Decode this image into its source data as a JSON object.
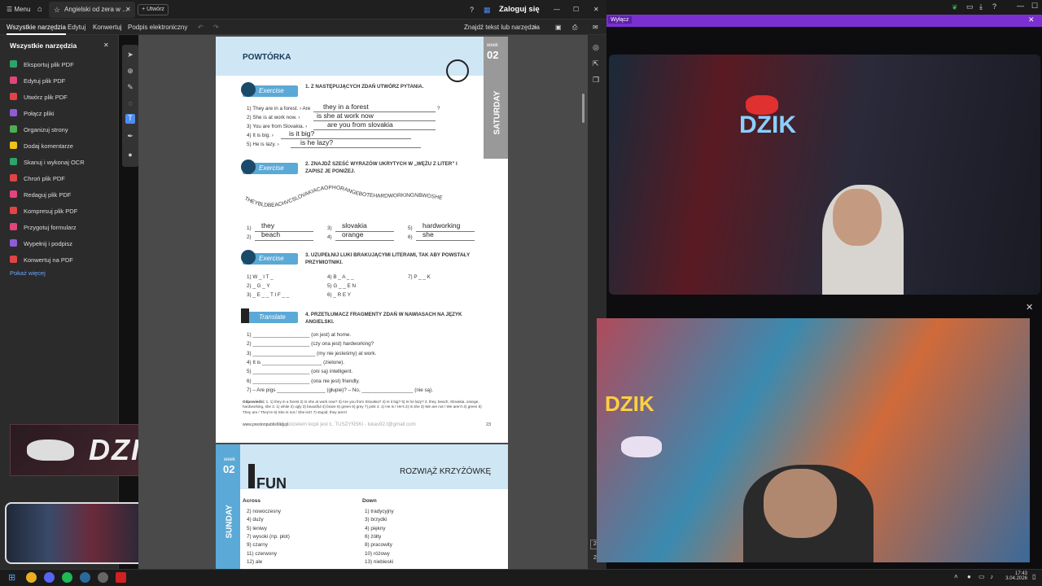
{
  "window": {
    "menu_label": "Menu",
    "tab_title": "Angielski od zera w ...",
    "new_tab_label": "Utwórz",
    "login_label": "Zaloguj się"
  },
  "toolbar": {
    "tabs": [
      "Wszystkie narzędzia",
      "Edytuj",
      "Konwertuj",
      "Podpis elektroniczny"
    ],
    "search_label": "Znajdź tekst lub narzędzia"
  },
  "sidebar": {
    "title": "Wszystkie narzędzia",
    "items": [
      {
        "label": "Eksportuj plik PDF",
        "color": "#2fa36b"
      },
      {
        "label": "Edytuj plik PDF",
        "color": "#e0457b"
      },
      {
        "label": "Utwórz plik PDF",
        "color": "#e04545"
      },
      {
        "label": "Połącz pliki",
        "color": "#8f5bd6"
      },
      {
        "label": "Organizuj strony",
        "color": "#4caf50"
      },
      {
        "label": "Dodaj komentarze",
        "color": "#f0c419"
      },
      {
        "label": "Skanuj i wykonaj OCR",
        "color": "#2fa36b"
      },
      {
        "label": "Chroń plik PDF",
        "color": "#e04545"
      },
      {
        "label": "Redaguj plik PDF",
        "color": "#e0457b"
      },
      {
        "label": "Kompresuj plik PDF",
        "color": "#e04545"
      },
      {
        "label": "Przygotuj formularz",
        "color": "#e0457b"
      },
      {
        "label": "Wypełnij i podpisz",
        "color": "#8f5bd6"
      },
      {
        "label": "Konwertuj na PDF",
        "color": "#e04545"
      }
    ],
    "show_more": "Pokaż więcej"
  },
  "page1": {
    "section": "POWTÓRKA",
    "week_label": "week",
    "week_num": "02",
    "day": "SATURDAY",
    "ex1_badge": "Exercise",
    "ex1_title": "1. Z NASTĘPUJĄCYCH ZDAŃ UTWÓRZ PYTANIA.",
    "ex1_lines": [
      {
        "prompt": "1)  They are in a forest.  › Are",
        "answer": "they in a forest",
        "end": "?"
      },
      {
        "prompt": "2)  She is at work now.  ›",
        "answer": "is she at work now",
        "end": ""
      },
      {
        "prompt": "3)  You are from Slovakia.  ›",
        "answer": "are you from slovakia",
        "end": ""
      },
      {
        "prompt": "4)  It is big.  ›",
        "answer": "is it big?",
        "end": ""
      },
      {
        "prompt": "5)  He is lazy.  ›",
        "answer": "is he lazy?",
        "end": ""
      }
    ],
    "ex2_badge": "Exercise",
    "ex2_title": "2. ZNAJDŹ SZEŚĆ WYRAZÓW UKRYTYCH W „WĘŻU Z LITER” I ZAPISZ JE PONIŻEJ.",
    "snake": "THEYBLDBEACHVCSLOVAKIACAOPHORANGEBOTEHARDWORKINGNBWOSHE",
    "ex2_answers": [
      {
        "n": "1)",
        "a": "they"
      },
      {
        "n": "2)",
        "a": "beach"
      },
      {
        "n": "3)",
        "a": "slovakia"
      },
      {
        "n": "4)",
        "a": "orange"
      },
      {
        "n": "5)",
        "a": "hardworking"
      },
      {
        "n": "6)",
        "a": "she"
      }
    ],
    "ex3_badge": "Exercise",
    "ex3_title": "3. UZUPEŁNIJ LUKI BRAKUJĄCYMI LITERAMI, TAK ABY POWSTAŁY PRZYMIOTNIKI.",
    "ex3_items": [
      "1)  W _ I T _",
      "2)  _ G _ Y",
      "3)  _ E _ _ T I F _ _",
      "4)  B _ A _ _",
      "5)  G _ _ E N",
      "6)  _ R E Y",
      "7)  P _ _ K"
    ],
    "tr_badge": "Translate",
    "tr_title": "4. PRZETŁUMACZ FRAGMENTY ZDAŃ W NAWIASACH NA JĘZYK ANGIELSKI.",
    "tr_lines": [
      "1)  ____________________ (on jest) at home.",
      "2)  ____________________ (czy ona jest) hardworking?",
      "3)  ______________________ (my nie jesteśmy) at work.",
      "4)  It is _____________________ (zielone).",
      "5)  ____________________ (oni są) intelligent.",
      "6)  ____________________ (ona nie jest) friendly.",
      "7)  – Are pigs _________________ (głupie)? – No, __________________ (nie są)."
    ],
    "answers_label": "Odpowiedzi:",
    "answers_text": "1. 1) they in a forest 2) Is she at work now? 3) Are you from Slovakia? 4) Is it big? 5) Is he lazy? 2. they, beach, Slovakia, orange, hardworking, she 3. 1) white 2) ugly 3) beautiful 4) brave 5) green 6) grey 7) pink 4. 1) He is / He's 2) Is she 3) We are not / We aren't 4) green 5) They are / They're 6) She is not / She isn't 7) stupid, they aren't",
    "footer_url": "www.prestonpublishing.pl",
    "footer_owner": "Właścicielem kopii jest Ł. TUSZYŃSKI - lukas92.t@gmail.com",
    "page_num": "23"
  },
  "page2": {
    "week_label": "week",
    "week_num": "02",
    "day": "SUNDAY",
    "fun_label": "FUN",
    "title": "ROZWIĄŻ KRZYŻÓWKĘ",
    "across_label": "Across",
    "across": [
      "2) nowoczesny",
      "4) duży",
      "5) leniwy",
      "7) wysoki (np. płot)",
      "9) czarny",
      "11) czerwony",
      "12) ale"
    ],
    "down_label": "Down",
    "down": [
      "1) tradycyjny",
      "3) brzydki",
      "4) piękny",
      "6) żółty",
      "8) pracowity",
      "10) różowy",
      "13) niebieski"
    ]
  },
  "stream": {
    "brand": "DZIK",
    "bar_text": "Wyłącz"
  },
  "taskbar": {
    "time": "17:43",
    "date": "3.04.2026"
  },
  "right_rail": {
    "page_a": "2",
    "page_b": "2"
  }
}
